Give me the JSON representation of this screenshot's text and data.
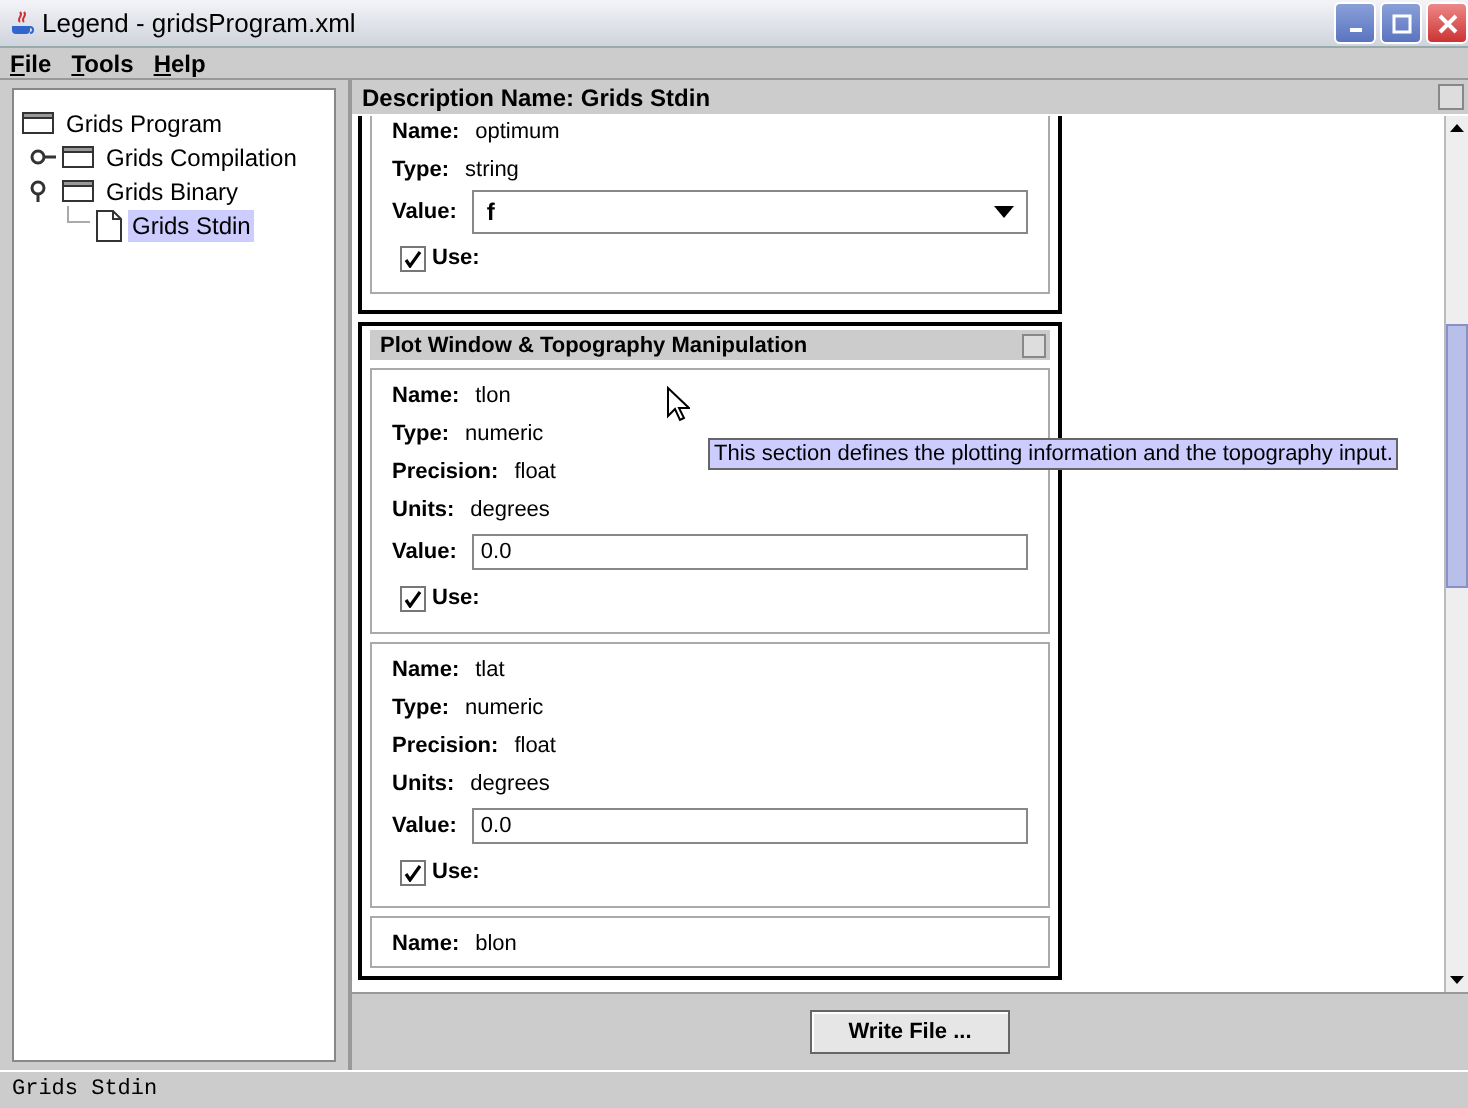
{
  "window": {
    "title": "Legend - gridsProgram.xml"
  },
  "menu": [
    {
      "label": "File"
    },
    {
      "label": "Tools"
    },
    {
      "label": "Help"
    }
  ],
  "tree": [
    {
      "label": "Grids Program",
      "kind": "folder",
      "selected": false,
      "children": [
        {
          "label": "Grids Compilation",
          "kind": "folder",
          "selected": false,
          "expanded": false
        },
        {
          "label": "Grids Binary",
          "kind": "folder",
          "selected": false,
          "expanded": true,
          "children": [
            {
              "label": "Grids Stdin",
              "kind": "file",
              "selected": true
            }
          ]
        }
      ]
    }
  ],
  "panel": {
    "title": "Description Name: Grids Stdin"
  },
  "sections": [
    {
      "params": [
        {
          "fields": [
            {
              "label": "Name:",
              "value": "optimum"
            },
            {
              "label": "Type:",
              "value": "string"
            }
          ],
          "value_label": "Value:",
          "value": "f",
          "kind": "dropdown",
          "use_label": "Use:",
          "use": true
        }
      ]
    },
    {
      "title": "Plot Window & Topography Manipulation",
      "params": [
        {
          "fields": [
            {
              "label": "Name:",
              "value": "tlon"
            },
            {
              "label": "Type:",
              "value": "numeric"
            },
            {
              "label": "Precision:",
              "value": "float"
            },
            {
              "label": "Units:",
              "value": "degrees"
            }
          ],
          "value_label": "Value:",
          "value": "0.0",
          "kind": "text",
          "use_label": "Use:",
          "use": true
        },
        {
          "fields": [
            {
              "label": "Name:",
              "value": "tlat"
            },
            {
              "label": "Type:",
              "value": "numeric"
            },
            {
              "label": "Precision:",
              "value": "float"
            },
            {
              "label": "Units:",
              "value": "degrees"
            }
          ],
          "value_label": "Value:",
          "value": "0.0",
          "kind": "text",
          "use_label": "Use:",
          "use": true
        },
        {
          "fields": [
            {
              "label": "Name:",
              "value": "blon"
            }
          ],
          "kind": "partial"
        }
      ]
    }
  ],
  "tooltip": "This section defines the plotting information and the topography input.",
  "button": "Write File ...",
  "status_bar": "Grids Stdin"
}
